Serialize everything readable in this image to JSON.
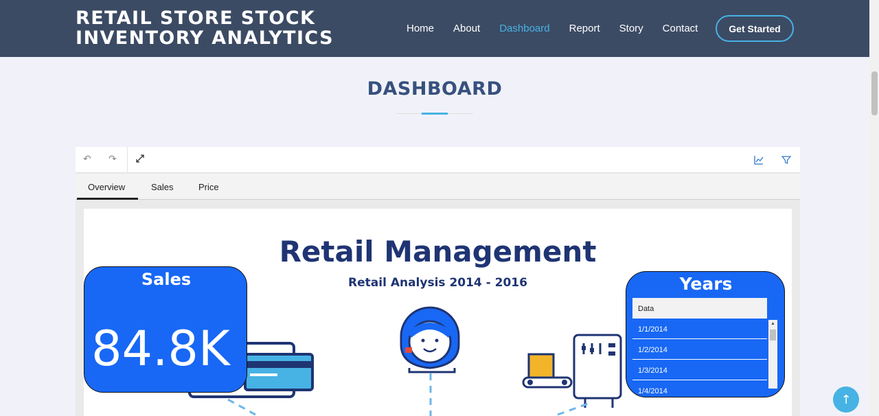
{
  "header": {
    "brand_line1": "RETAIL STORE STOCK",
    "brand_line2": "INVENTORY ANALYTICS",
    "nav": [
      "Home",
      "About",
      "Dashboard",
      "Report",
      "Story",
      "Contact"
    ],
    "active_nav": "Dashboard",
    "cta": "Get Started"
  },
  "section": {
    "title": "DASHBOARD"
  },
  "embed": {
    "toolbar": {
      "icons": [
        "undo-icon",
        "redo-icon",
        "expand-icon",
        "chart-icon",
        "filter-icon"
      ]
    },
    "tabs": [
      "Overview",
      "Sales",
      "Price"
    ],
    "active_tab": "Overview",
    "report": {
      "title": "Retail Management",
      "subtitle": "Retail Analysis 2014 - 2016",
      "sales_card": {
        "label": "Sales",
        "value": "84.8K"
      },
      "years_card": {
        "label": "Years",
        "slicer_header": "Data",
        "options": [
          "1/1/2014",
          "1/2/2014",
          "1/3/2014",
          "1/4/2014"
        ]
      }
    }
  },
  "colors": {
    "header_bg": "#3c4b64",
    "accent": "#47b2e4",
    "card_blue": "#1868f5",
    "title_navy": "#1f3473"
  },
  "scroll_top_icon": "arrow-up-icon"
}
